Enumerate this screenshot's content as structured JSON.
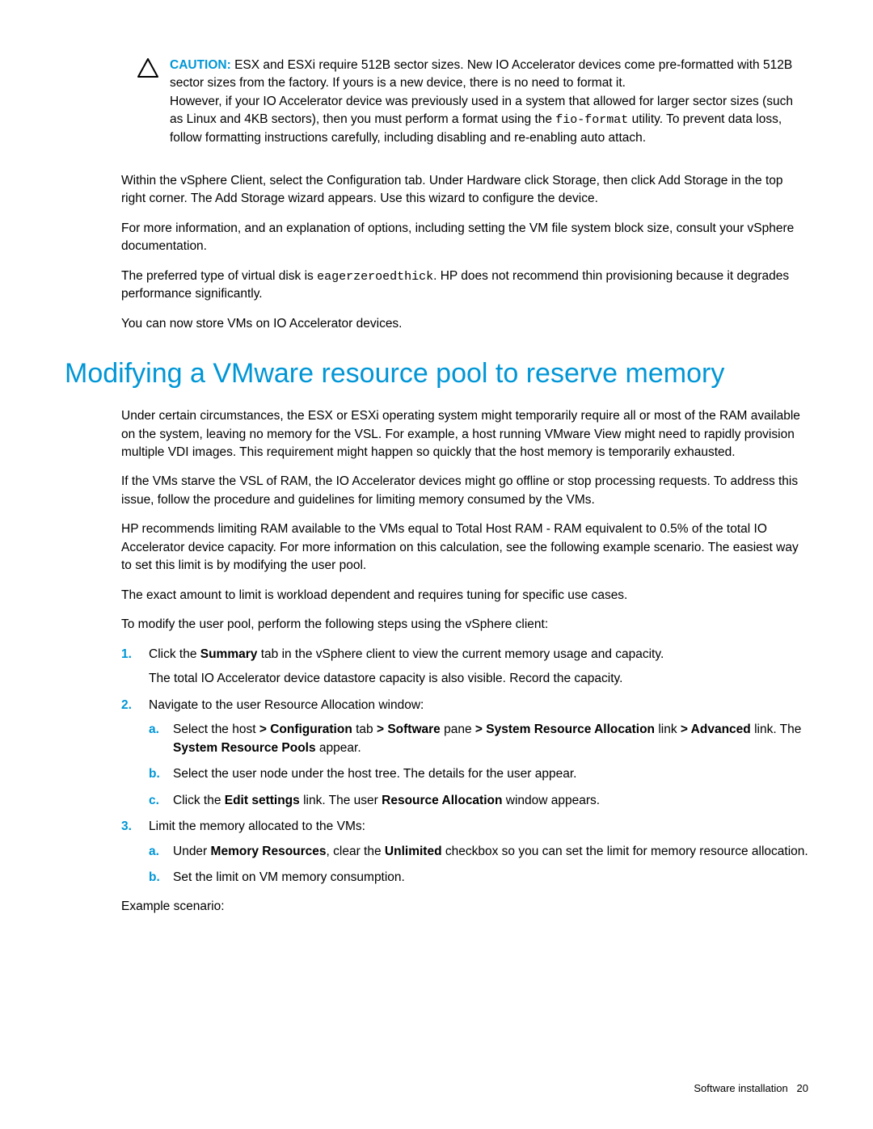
{
  "caution": {
    "label": "CAUTION:",
    "p1_a": "ESX and ESXi require 512B sector sizes. New IO Accelerator devices come pre-formatted with 512B sector sizes from the factory. If yours is a new device, there is no need to format it.",
    "p2_a": "However, if your IO Accelerator device was previously used in a system that allowed for larger sector sizes (such as Linux and 4KB sectors), then you must perform a format using the ",
    "p2_code": "fio-format",
    "p2_b": " utility. To prevent data loss, follow formatting instructions carefully, including disabling and re-enabling auto attach."
  },
  "intro": {
    "p1": "Within the vSphere Client, select the Configuration tab. Under Hardware click Storage, then click Add Storage in the top right corner. The Add Storage wizard appears. Use this wizard to configure the device.",
    "p2": "For more information, and an explanation of options, including setting the VM file system block size, consult your vSphere documentation.",
    "p3_a": "The preferred type of virtual disk is ",
    "p3_code": "eagerzeroedthick",
    "p3_b": ". HP does not recommend thin provisioning because it degrades performance significantly.",
    "p4": "You can now store VMs on IO Accelerator devices."
  },
  "heading": "Modifying a VMware resource pool to reserve memory",
  "section": {
    "p1": "Under certain circumstances, the ESX or ESXi operating system might temporarily require all or most of the RAM available on the system, leaving no memory for the VSL. For example, a host running VMware View might need to rapidly provision multiple VDI images. This requirement might happen so quickly that the host memory is temporarily exhausted.",
    "p2": "If the VMs starve the VSL of RAM, the IO Accelerator devices might go offline or stop processing requests. To address this issue, follow the procedure and guidelines for limiting memory consumed by the VMs.",
    "p3": "HP recommends limiting RAM available to the VMs equal to Total Host RAM - RAM equivalent to 0.5% of the total IO Accelerator device capacity. For more information on this calculation, see the following example scenario. The easiest way to set this limit is by modifying the user pool.",
    "p4": "The exact amount to limit is workload dependent and requires tuning for specific use cases.",
    "p5": "To modify the user pool, perform the following steps using the vSphere client:",
    "p6": "Example scenario:"
  },
  "steps": {
    "s1": {
      "num": "1.",
      "line1_a": "Click the ",
      "line1_b": "Summary",
      "line1_c": " tab in the vSphere client to view the current memory usage and capacity.",
      "line2": "The total IO Accelerator device datastore capacity is also visible. Record the capacity."
    },
    "s2": {
      "num": "2.",
      "line1": "Navigate to the user Resource Allocation window:",
      "a": {
        "num": "a.",
        "t1": "Select the host ",
        "b1": "> Configuration",
        "t2": " tab ",
        "b2": "> Software",
        "t3": " pane ",
        "b3": "> System Resource Allocation",
        "t4": " link ",
        "b4": "> Advanced",
        "t5": " link. The ",
        "b5": "System Resource Pools",
        "t6": " appear."
      },
      "b": {
        "num": "b.",
        "t": "Select the user node under the host tree. The details for the user appear."
      },
      "c": {
        "num": "c.",
        "t1": "Click the ",
        "b1": "Edit settings",
        "t2": " link. The user ",
        "b2": "Resource Allocation",
        "t3": " window appears."
      }
    },
    "s3": {
      "num": "3.",
      "line1": "Limit the memory allocated to the VMs:",
      "a": {
        "num": "a.",
        "t1": "Under ",
        "b1": "Memory Resources",
        "t2": ", clear the ",
        "b2": "Unlimited",
        "t3": " checkbox so you can set the limit for memory resource allocation."
      },
      "b": {
        "num": "b.",
        "t": "Set the limit on VM memory consumption."
      }
    }
  },
  "footer": {
    "section": "Software installation",
    "page": "20"
  }
}
